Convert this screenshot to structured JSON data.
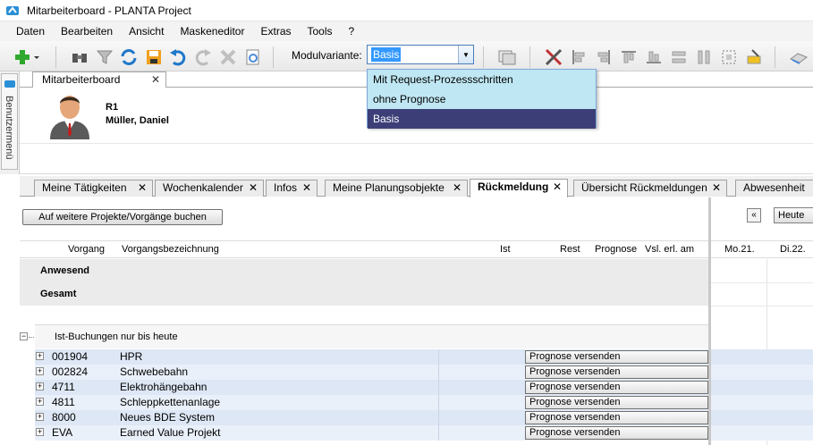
{
  "window": {
    "title": "Mitarbeiterboard - PLANTA Project"
  },
  "menu": [
    "Daten",
    "Bearbeiten",
    "Ansicht",
    "Maskeneditor",
    "Extras",
    "Tools",
    "?"
  ],
  "toolbar": {
    "modul_label": "Modulvariante:",
    "modul_value": "Basis"
  },
  "dropdown": {
    "options": [
      "Mit Request-Prozessschritten",
      "ohne Prognose",
      "Basis"
    ],
    "selected": "Basis"
  },
  "sidebar": {
    "label": "Benutzermenü"
  },
  "workspace_tab": {
    "label": "Mitarbeiterboard"
  },
  "user": {
    "id": "R1",
    "name": "Müller, Daniel"
  },
  "tabs": [
    {
      "label": "Meine Tätigkeiten",
      "active": false
    },
    {
      "label": "Wochenkalender",
      "active": false
    },
    {
      "label": "Infos",
      "active": false
    },
    {
      "label": "Meine Planungsobjekte",
      "active": false
    },
    {
      "label": "Rückmeldung",
      "active": true
    },
    {
      "label": "Übersicht Rückmeldungen",
      "active": false
    },
    {
      "label": "Abwesenheit",
      "active": false
    }
  ],
  "content": {
    "book_button": "Auf weitere Projekte/Vorgänge buchen",
    "cal_prev": "«",
    "cal_today": "Heute",
    "columns": {
      "vorgang": "Vorgang",
      "bezeichnung": "Vorgangsbezeichnung",
      "ist": "Ist",
      "rest": "Rest",
      "prognose": "Prognose",
      "vsl": "Vsl. erl. am"
    },
    "cal_days": [
      "Mo.21.",
      "Di.22."
    ],
    "sections": [
      "Anwesend",
      "Gesamt"
    ],
    "group": "Ist-Buchungen nur bis heute",
    "send_label": "Prognose versenden",
    "projects": [
      {
        "nr": "001904",
        "name": "HPR"
      },
      {
        "nr": "002824",
        "name": "Schwebebahn"
      },
      {
        "nr": "4711",
        "name": "Elektrohängebahn"
      },
      {
        "nr": "4811",
        "name": "Schleppkettenanlage"
      },
      {
        "nr": "8000",
        "name": "Neues BDE System"
      },
      {
        "nr": "EVA",
        "name": "Earned Value Projekt"
      }
    ]
  }
}
